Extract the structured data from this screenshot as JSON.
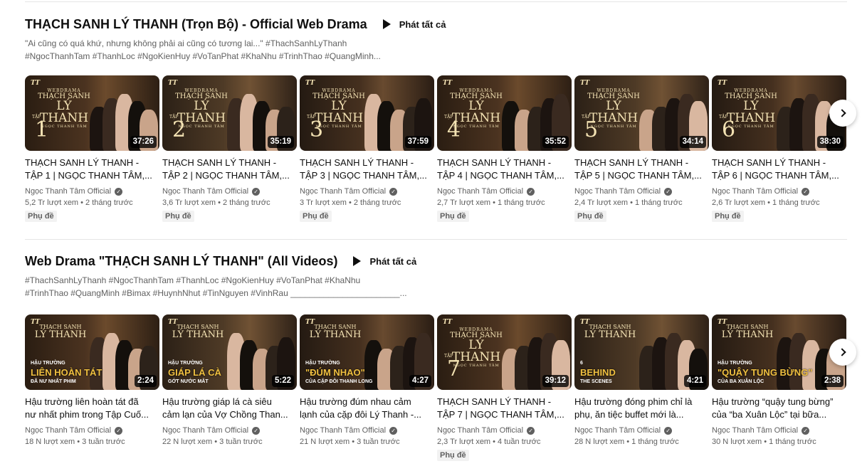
{
  "shelves": [
    {
      "title": "THẠCH SANH LÝ THANH (Trọn Bộ) - Official Web Drama",
      "play_all": "Phát tất cả",
      "desc_line1": "\"Ai cũng có quá khứ, nhưng không phải ai cũng có tương lai...\" #ThachSanhLyThanh",
      "desc_line2": "#NgocThanhTam #ThanhLoc #NgoKienHuy #VoTanPhat #KhaNhu #TrinhThao #QuangMinh...",
      "videos": [
        {
          "title1": "THẠCH SANH LÝ THANH -",
          "title2": "TẬP 1 | NGỌC THANH TÂM,...",
          "duration": "37:26",
          "channel": "Ngọc Thanh Tâm Official",
          "meta": "5,2 Tr lượt xem • 2 tháng trước",
          "badge": "Phụ đề",
          "ep": "1"
        },
        {
          "title1": "THẠCH SANH LÝ THANH -",
          "title2": "TẬP 2 | NGỌC THANH TÂM,...",
          "duration": "35:19",
          "channel": "Ngọc Thanh Tâm Official",
          "meta": "3,6 Tr lượt xem • 2 tháng trước",
          "badge": "Phụ đề",
          "ep": "2"
        },
        {
          "title1": "THẠCH SANH LÝ THANH -",
          "title2": "TẬP 3 | NGỌC THANH TÂM,...",
          "duration": "37:59",
          "channel": "Ngọc Thanh Tâm Official",
          "meta": "3 Tr lượt xem • 2 tháng trước",
          "badge": "Phụ đề",
          "ep": "3"
        },
        {
          "title1": "THẠCH SANH LÝ THANH -",
          "title2": "TẬP 4 | NGỌC THANH TÂM,...",
          "duration": "35:52",
          "channel": "Ngọc Thanh Tâm Official",
          "meta": "2,7 Tr lượt xem • 1 tháng trước",
          "badge": "Phụ đề",
          "ep": "4"
        },
        {
          "title1": "THẠCH SANH LÝ THANH -",
          "title2": "TẬP 5 | NGỌC THANH TÂM,...",
          "duration": "34:14",
          "channel": "Ngọc Thanh Tâm Official",
          "meta": "2,4 Tr lượt xem • 1 tháng trước",
          "badge": "Phụ đề",
          "ep": "5"
        },
        {
          "title1": "THẠCH SANH LÝ THANH -",
          "title2": "TẬP 6 | NGỌC THANH TÂM,...",
          "duration": "38:30",
          "channel": "Ngọc Thanh Tâm Official",
          "meta": "2,6 Tr lượt xem • 1 tháng trước",
          "badge": "Phụ đề",
          "ep": "6"
        }
      ]
    },
    {
      "title": "Web Drama \"THẠCH SANH LÝ THANH\" (All Videos)",
      "play_all": "Phát tất cả",
      "desc_line1": "#ThachSanhLyThanh #NgocThanhTam #ThanhLoc #NgoKienHuy #VoTanPhat #KhaNhu",
      "desc_line2": "#TrinhThao #QuangMinh #Bimax #HuynhNhut #TinNguyen #VinhRau _______________________...",
      "videos": [
        {
          "title1": "Hậu trường liên hoàn tát đã",
          "title2": "nư nhất phim trong Tập Cuố...",
          "duration": "2:24",
          "channel": "Ngọc Thanh Tâm Official",
          "meta": "18 N lượt xem • 3 tuần trước",
          "badge": "",
          "art_head": "HẬU TRƯỜNG",
          "art_main": "LIÊN HOÀN TÁT",
          "art_sub": "ĐÃ NƯ NHẤT PHIM"
        },
        {
          "title1": "Hậu trường giáp lá cà siêu",
          "title2": "cảm lạn của Vợ Chồng Than...",
          "duration": "5:22",
          "channel": "Ngọc Thanh Tâm Official",
          "meta": "22 N lượt xem • 3 tuần trước",
          "badge": "",
          "art_head": "HẬU TRƯỜNG",
          "art_main": "GIÁP LÁ CÀ",
          "art_sub": "GỚT NƯỚC MẮT"
        },
        {
          "title1": "Hậu trường đúm nhau cảm",
          "title2": "lạnh của cặp đôi Lý Thanh -...",
          "duration": "4:27",
          "channel": "Ngọc Thanh Tâm Official",
          "meta": "21 N lượt xem • 3 tuần trước",
          "badge": "",
          "art_head": "HẬU TRƯỜNG",
          "art_main": "\"ĐÚM NHAO\"",
          "art_sub": "CỦA CẶP ĐÔI THANH LONG"
        },
        {
          "title1": "THẠCH SANH LÝ THANH -",
          "title2": "TẬP 7 | NGỌC THANH TÂM,...",
          "duration": "39:12",
          "channel": "Ngọc Thanh Tâm Official",
          "meta": "2,3 Tr lượt xem • 4 tuần trước",
          "badge": "Phụ đề",
          "ep": "7"
        },
        {
          "title1": "Hậu trường đóng phim chỉ là",
          "title2": "phụ, ăn tiệc buffet mới là...",
          "duration": "4:21",
          "channel": "Ngọc Thanh Tâm Official",
          "meta": "28 N lượt xem • 1 tháng trước",
          "badge": "",
          "art_head": "6",
          "art_main": "BEHIND",
          "art_sub": "THE SCENES"
        },
        {
          "title1": "Hậu trường “quậy tung bừng”",
          "title2": "của “ba Xuân Lộc” tại bữa...",
          "duration": "2:38",
          "channel": "Ngọc Thanh Tâm Official",
          "meta": "30 N lượt xem • 1 tháng trước",
          "badge": "",
          "art_head": "HẬU TRƯỜNG",
          "art_main": "\"QUẬY TUNG BỪNG\"",
          "art_sub": "CỦA BA XUÂN LỘC"
        }
      ]
    }
  ],
  "thumb_art": {
    "logo": "TT",
    "series_small": "WEBDRAMA",
    "series_mid": "THẠCH SANH",
    "series_big": "LÝ THANH",
    "series_tiny": "NGỌC THANH TÂM",
    "tap": "TẬP"
  },
  "icons": {
    "play_all": "play-icon",
    "verified": "verified-check-icon",
    "next": "chevron-right-icon"
  },
  "colors": {
    "gold_text": "#f3e2b3",
    "highlight": "#f0c040",
    "muted": "#606060"
  }
}
